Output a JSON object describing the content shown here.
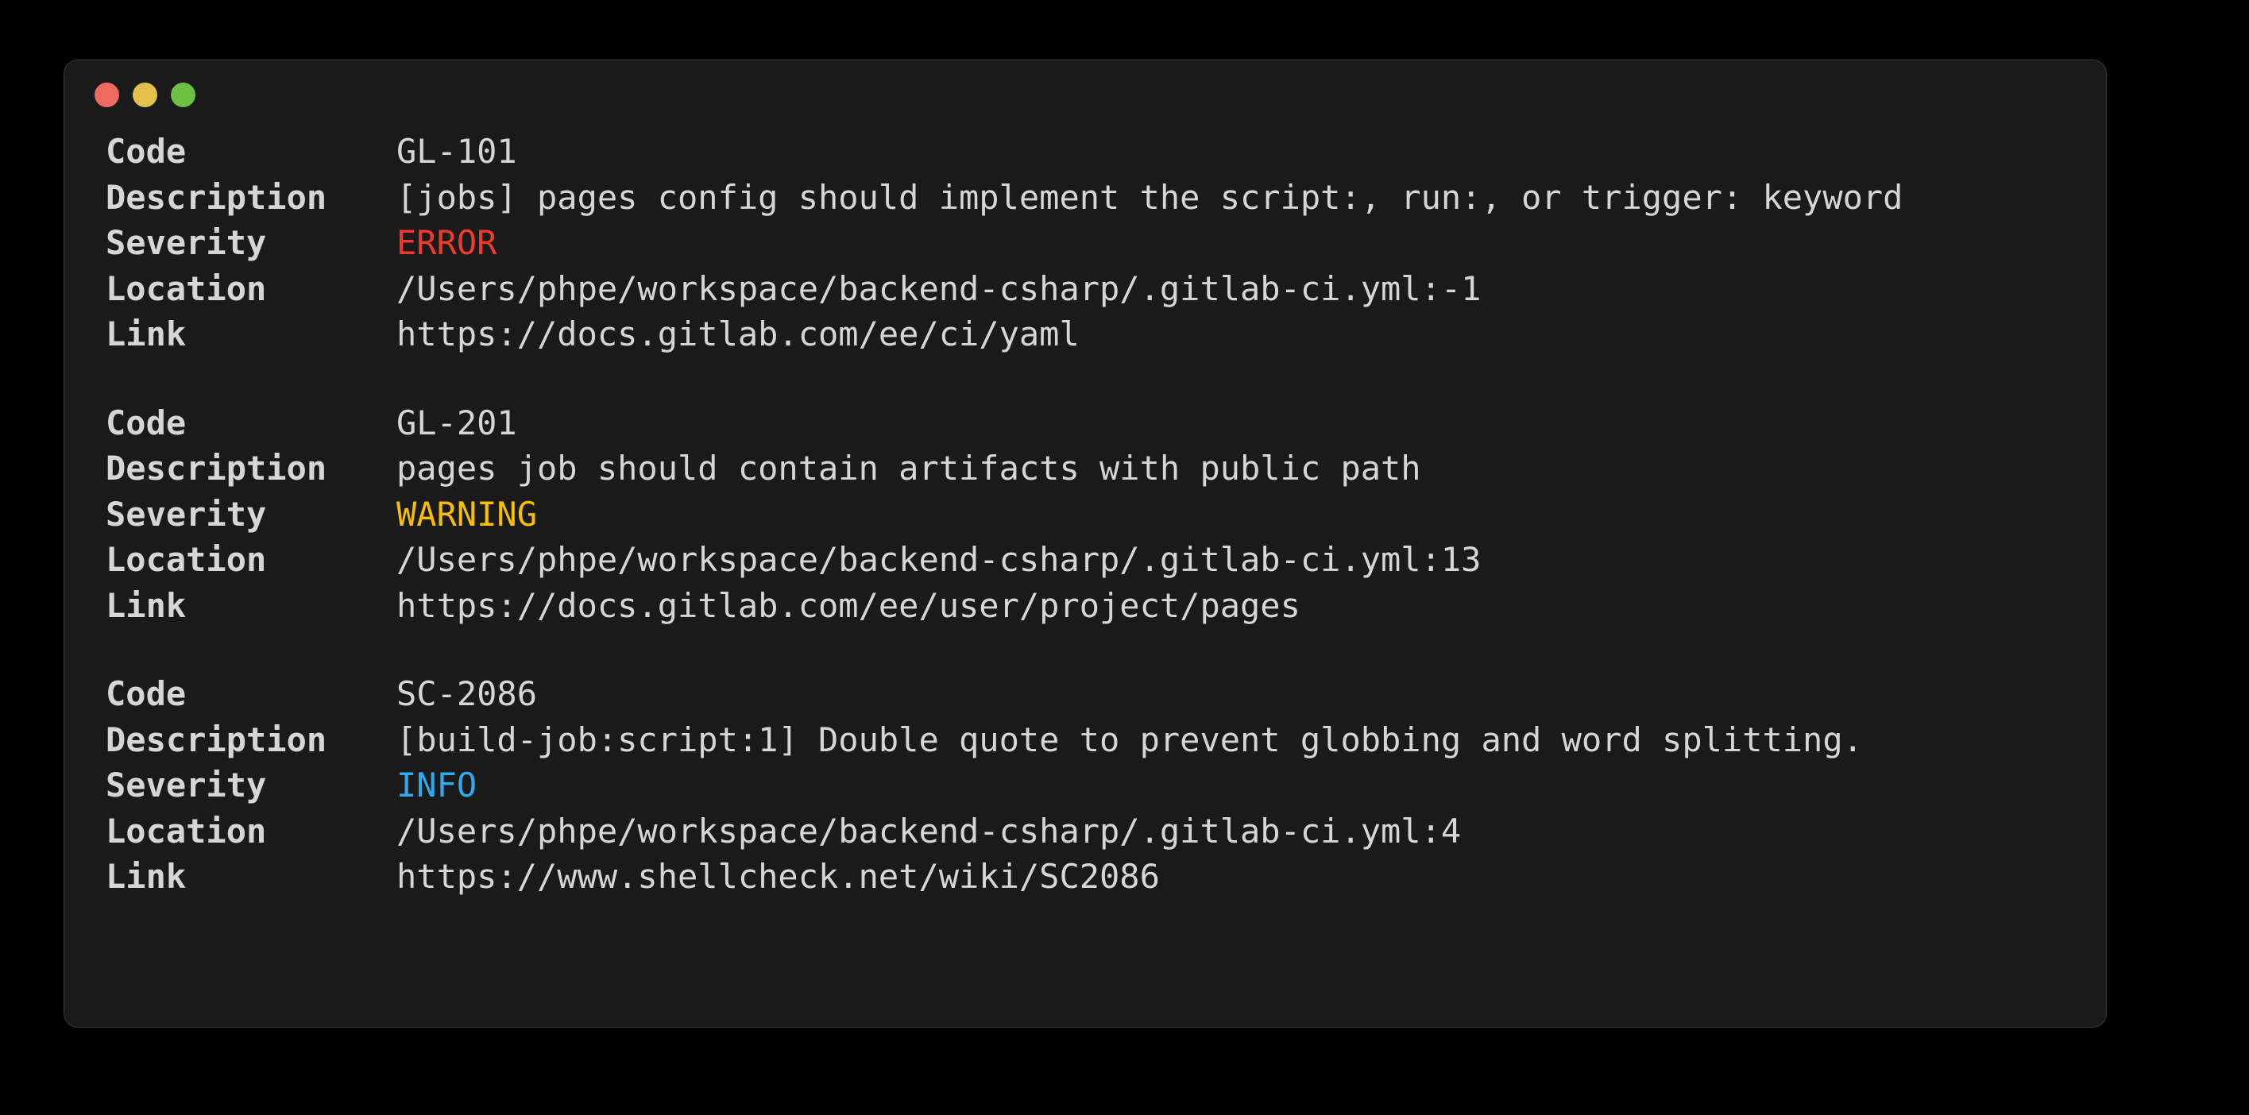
{
  "window": {
    "background_color": "#1a1a1a",
    "desktop_background_color": "#000000",
    "traffic_lights": [
      {
        "name": "close",
        "color": "#ec6a5e"
      },
      {
        "name": "minimize",
        "color": "#e2c04a"
      },
      {
        "name": "maximize",
        "color": "#6cbf43"
      }
    ]
  },
  "labels": {
    "code": "Code",
    "description": "Description",
    "severity": "Severity",
    "location": "Location",
    "link": "Link"
  },
  "severity_colors": {
    "ERROR": "#ef3b2c",
    "WARNING": "#f7bf00",
    "INFO": "#2eabf0"
  },
  "findings": [
    {
      "code": "GL-101",
      "description": "[jobs] pages config should implement the script:, run:, or trigger: keyword",
      "severity": "ERROR",
      "location": "/Users/phpe/workspace/backend-csharp/.gitlab-ci.yml:-1",
      "link": "https://docs.gitlab.com/ee/ci/yaml"
    },
    {
      "code": "GL-201",
      "description": "pages job should contain artifacts with public path",
      "severity": "WARNING",
      "location": "/Users/phpe/workspace/backend-csharp/.gitlab-ci.yml:13",
      "link": "https://docs.gitlab.com/ee/user/project/pages"
    },
    {
      "code": "SC-2086",
      "description": "[build-job:script:1] Double quote to prevent globbing and word splitting.",
      "severity": "INFO",
      "location": "/Users/phpe/workspace/backend-csharp/.gitlab-ci.yml:4",
      "link": "https://www.shellcheck.net/wiki/SC2086"
    }
  ]
}
